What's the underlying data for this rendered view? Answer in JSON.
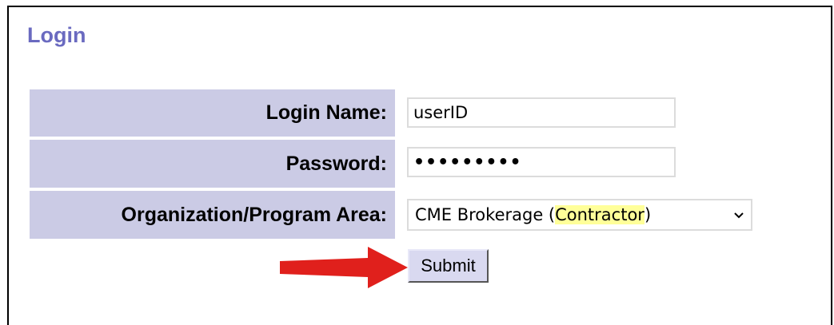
{
  "form": {
    "title": "Login",
    "login_name_label": "Login Name:",
    "login_name_value": "userID",
    "password_label": "Password:",
    "password_value": "•••••••••",
    "org_label": "Organization/Program Area:",
    "org_selected_prefix": "CME Brokerage (",
    "org_selected_highlight": "Contractor",
    "org_selected_suffix": ")",
    "submit_label": "Submit"
  },
  "colors": {
    "title": "#6a6ac0",
    "label_background": "#cbcbe5",
    "highlight": "#ffff99",
    "arrow": "#e0201c",
    "button": "#d9d9f0"
  },
  "icons": {
    "dropdown": "chevron-down-icon",
    "annotation": "red-arrow-icon"
  }
}
